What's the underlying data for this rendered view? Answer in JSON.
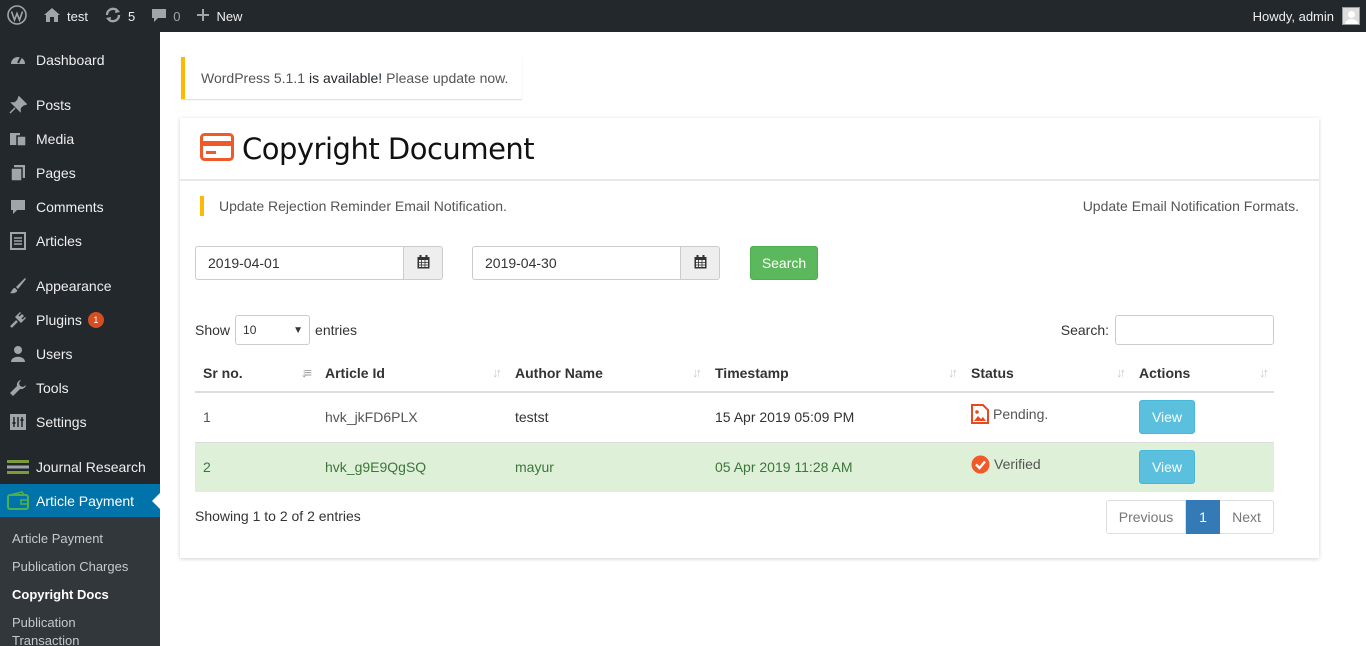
{
  "adminbar": {
    "site_name": "test",
    "updates_count": "5",
    "comments_count": "0",
    "new_label": "New",
    "howdy": "Howdy, admin"
  },
  "sidebar": {
    "items": [
      {
        "label": "Dashboard",
        "icon": "dashboard-icon"
      },
      {
        "label": "Posts",
        "icon": "pin-icon"
      },
      {
        "label": "Media",
        "icon": "media-icon"
      },
      {
        "label": "Pages",
        "icon": "pages-icon"
      },
      {
        "label": "Comments",
        "icon": "comments-icon"
      },
      {
        "label": "Articles",
        "icon": "document-icon"
      },
      {
        "label": "Appearance",
        "icon": "brush-icon"
      },
      {
        "label": "Plugins",
        "icon": "plugin-icon",
        "badge": "1"
      },
      {
        "label": "Users",
        "icon": "user-icon"
      },
      {
        "label": "Tools",
        "icon": "wrench-icon"
      },
      {
        "label": "Settings",
        "icon": "settings-icon"
      },
      {
        "label": "Journal Research",
        "icon": "journal-icon"
      },
      {
        "label": "Article Payment",
        "icon": "wallet-icon"
      }
    ],
    "submenu": [
      {
        "label": "Article Payment"
      },
      {
        "label": "Publication Charges"
      },
      {
        "label": "Copyright Docs"
      },
      {
        "label": "Publication"
      },
      {
        "label": "Transaction"
      }
    ]
  },
  "notice": {
    "version_link": "WordPress 5.1.1",
    "available": "is available!",
    "update_link": "Please update now."
  },
  "page": {
    "title": "Copyright Document",
    "rejection_link": "Update Rejection Reminder Email Notification.",
    "formats_link": "Update Email Notification Formats."
  },
  "filters": {
    "date_from": "2019-04-01",
    "date_to": "2019-04-30",
    "search_label": "Search"
  },
  "table": {
    "show_label": "Show",
    "length_value": "10",
    "entries_label": "entries",
    "search_label": "Search:",
    "columns": [
      "Sr no.",
      "Article Id",
      "Author Name",
      "Timestamp",
      "Status",
      "Actions"
    ],
    "rows": [
      {
        "sr": "1",
        "article_id": "hvk_jkFD6PLX",
        "author": "testst",
        "timestamp": "15 Apr 2019 05:09 PM",
        "status": "Pending.",
        "status_icon": "image-icon",
        "action": "View"
      },
      {
        "sr": "2",
        "article_id": "hvk_g9E9QgSQ",
        "author": "mayur",
        "timestamp": "05 Apr 2019 11:28 AM",
        "status": "Verified",
        "status_icon": "check-circle-icon",
        "action": "View"
      }
    ],
    "info": "Showing 1 to 2 of 2 entries",
    "pager": {
      "previous": "Previous",
      "current": "1",
      "next": "Next"
    }
  },
  "colors": {
    "adminbar_bg": "#23282d",
    "accent_blue": "#0073aa",
    "search_green": "#5cb85c",
    "view_cyan": "#5bc0de",
    "notice_yellow": "#ffb900",
    "title_icon_orange": "#f05a28",
    "pager_blue": "#337ab7"
  }
}
